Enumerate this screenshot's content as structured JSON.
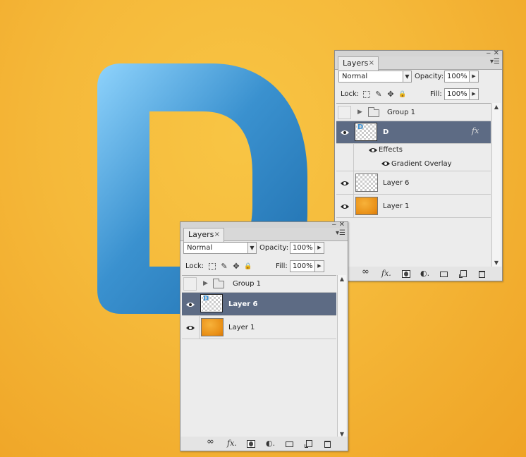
{
  "canvas": {
    "letter": "D",
    "letter_colors": [
      "#8fd2fb",
      "#3c93cf",
      "#1f6fae"
    ]
  },
  "panel_back": {
    "tab_label": "Layers",
    "blend_mode": "Normal",
    "opacity_label": "Opacity:",
    "opacity_value": "100%",
    "lock_label": "Lock:",
    "fill_label": "Fill:",
    "fill_value": "100%",
    "layers": [
      {
        "name": "Group 1",
        "type": "group",
        "visible": false
      },
      {
        "name": "D",
        "type": "text",
        "visible": true,
        "selected": true,
        "fx": "fx"
      },
      {
        "name": "Effects",
        "type": "effects-header",
        "visible": true
      },
      {
        "name": "Gradient Overlay",
        "type": "effect",
        "visible": true
      },
      {
        "name": "Layer 6",
        "type": "layer",
        "visible": true
      },
      {
        "name": "Layer 1",
        "type": "layer",
        "visible": true
      }
    ]
  },
  "panel_front": {
    "tab_label": "Layers",
    "blend_mode": "Normal",
    "opacity_label": "Opacity:",
    "opacity_value": "100%",
    "lock_label": "Lock:",
    "fill_label": "Fill:",
    "fill_value": "100%",
    "layers": [
      {
        "name": "Group 1",
        "type": "group",
        "visible": false
      },
      {
        "name": "Layer 6",
        "type": "layer",
        "visible": true,
        "selected": true
      },
      {
        "name": "Layer 1",
        "type": "layer",
        "visible": true
      }
    ]
  },
  "icons": {
    "close": "close-icon",
    "minimize": "minimize-icon",
    "panel_menu": "panel-menu-icon",
    "eye": "eye-icon",
    "link": "link-layers-icon",
    "fx": "fx-icon",
    "mask": "add-mask-icon",
    "adjustment": "adjustment-layer-icon",
    "group": "new-group-icon",
    "new_layer": "new-layer-icon",
    "trash": "delete-layer-icon"
  },
  "glyphs": {
    "close": "✕",
    "minimize": "‒",
    "tab_close": "×",
    "menu": "▾☰",
    "dropdown": "▼",
    "step": "▶",
    "expand": "▶",
    "scroll_up": "▲",
    "scroll_down": "▼",
    "brush": "✎",
    "move": "✥",
    "lock": "🔒",
    "link": "∞",
    "fx": "fx.",
    "adjust": "◐."
  }
}
